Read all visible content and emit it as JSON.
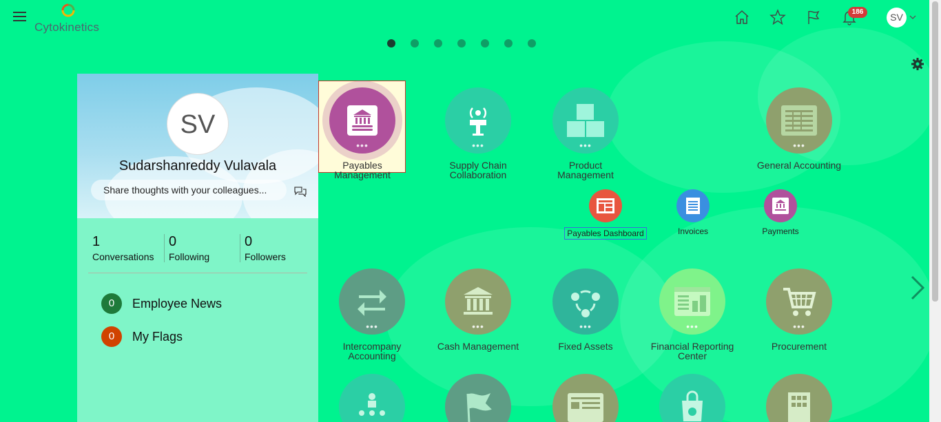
{
  "brand": {
    "name": "Cytokinetics"
  },
  "header": {
    "notification_count": "186",
    "user_initials": "SV"
  },
  "carousel": {
    "page_count": 7,
    "active_index": 0
  },
  "profile": {
    "initials": "SV",
    "name": "Sudarshanreddy Vulavala",
    "share_placeholder": "Share thoughts with your colleagues...",
    "stats": [
      {
        "count": "1",
        "label": "Conversations"
      },
      {
        "count": "0",
        "label": "Following"
      },
      {
        "count": "0",
        "label": "Followers"
      }
    ],
    "feeds": [
      {
        "count": "0",
        "label": "Employee News",
        "color": "#1e7a3a"
      },
      {
        "count": "0",
        "label": "My Flags",
        "color": "#d04300"
      }
    ]
  },
  "tiles": {
    "row1": [
      {
        "label_line1": "Payables",
        "label_line2": "Management",
        "color": "#b0519c",
        "icon": "bank-icon"
      },
      {
        "label_line1": "Supply Chain",
        "label_line2": "Collaboration",
        "color": "#2bcfa5",
        "icon": "radio-tower-icon"
      },
      {
        "label_line1": "Product",
        "label_line2": "Management",
        "color": "#2bcfa5",
        "icon": "boxes-icon"
      },
      {
        "label_line1": "General Accounting",
        "label_line2": "",
        "color": "#8fa06d",
        "icon": "ledger-icon"
      }
    ],
    "sub_tiles": [
      {
        "label": "Payables Dashboard",
        "color": "#e8563f",
        "icon": "dashboard-icon"
      },
      {
        "label": "Invoices",
        "color": "#3a8fe0",
        "icon": "document-icon"
      },
      {
        "label": "Payments",
        "color": "#b0519c",
        "icon": "bank-icon"
      }
    ],
    "row2": [
      {
        "label_line1": "Intercompany",
        "label_line2": "Accounting",
        "color": "#5e9d85",
        "icon": "transfer-icon"
      },
      {
        "label_line1": "Cash Management",
        "label_line2": "",
        "color": "#8fa06d",
        "icon": "bank-icon"
      },
      {
        "label_line1": "Fixed Assets",
        "label_line2": "",
        "color": "#2fb59b",
        "icon": "cycle-icon"
      },
      {
        "label_line1": "Financial Reporting",
        "label_line2": "Center",
        "color": "#7ff38a",
        "icon": "report-icon"
      },
      {
        "label_line1": "Procurement",
        "label_line2": "",
        "color": "#8fa06d",
        "icon": "cart-icon"
      }
    ],
    "row3": [
      {
        "color": "#2bcfa5",
        "icon": "org-chart-icon"
      },
      {
        "color": "#5e9d85",
        "icon": "flag-icon"
      },
      {
        "color": "#8fa06d",
        "icon": "workspace-icon"
      },
      {
        "color": "#2bcfa5",
        "icon": "shopping-bag-icon"
      },
      {
        "color": "#8fa06d",
        "icon": "building-icon"
      }
    ]
  }
}
